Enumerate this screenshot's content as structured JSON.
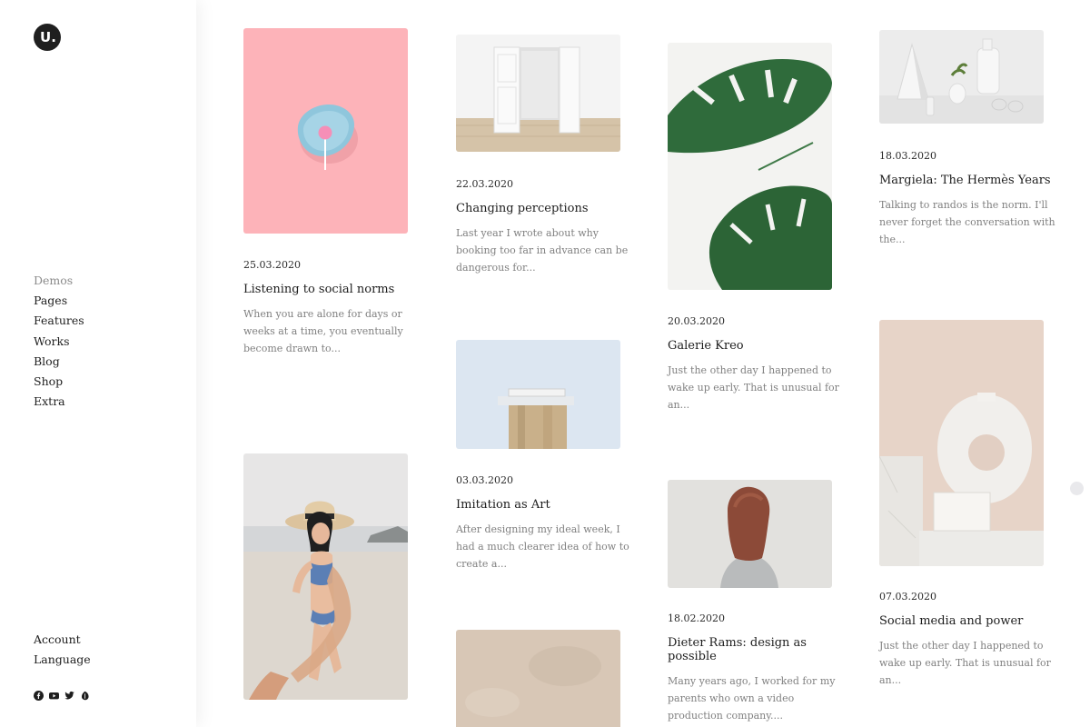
{
  "brand": {
    "logo_letter": "U."
  },
  "nav": {
    "items": [
      "Demos",
      "Pages",
      "Features",
      "Works",
      "Blog",
      "Shop",
      "Extra"
    ]
  },
  "account_nav": {
    "account": "Account",
    "language": "Language"
  },
  "social_icons": [
    "facebook-icon",
    "youtube-icon",
    "twitter-icon",
    "behance-icon"
  ],
  "posts": [
    {
      "date": "25.03.2020",
      "title": "Listening to social norms",
      "excerpt": "When you are alone for days or weeks at a time, you eventually become drawn to..."
    },
    {
      "date": "22.03.2020",
      "title": "Changing perceptions",
      "excerpt": "Last year I wrote about why booking too far in advance can be dangerous for..."
    },
    {
      "date": "20.03.2020",
      "title": "Galerie Kreo",
      "excerpt": "Just the other day I happened to wake up early. That is unusual for an..."
    },
    {
      "date": "18.03.2020",
      "title": "Margiela: The Hermès Years",
      "excerpt": "Talking to randos is the norm. I'll never forget the conversation with the..."
    },
    {
      "date": "03.03.2020",
      "title": "Imitation as Art",
      "excerpt": "After designing my ideal week, I had a much clearer idea of how to create a..."
    },
    {
      "date": "18.02.2020",
      "title": "Dieter Rams: design as possible",
      "excerpt": "Many years ago, I worked for my parents who own a video production company...."
    },
    {
      "date": "07.03.2020",
      "title": "Social media and power",
      "excerpt": "Just the other day I happened to wake up early. That is unusual for an..."
    }
  ]
}
